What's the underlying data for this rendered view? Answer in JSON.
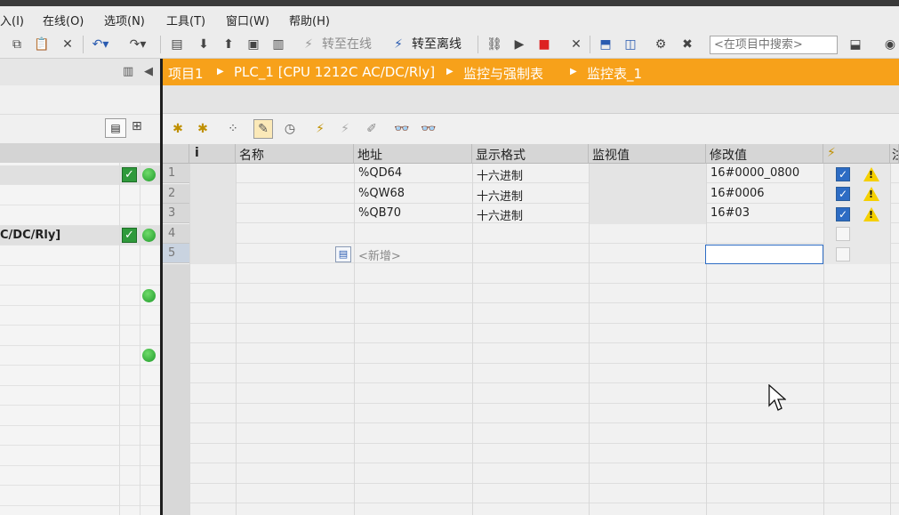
{
  "menu": [
    "入(I)",
    "在线(O)",
    "选项(N)",
    "工具(T)",
    "窗口(W)",
    "帮助(H)"
  ],
  "toolbar": {
    "go_online": "转至在线",
    "go_offline": "转至离线",
    "search_placeholder": "<在项目中搜索>"
  },
  "breadcrumb": [
    "项目1",
    "PLC_1 [CPU 1212C AC/DC/Rly]",
    "监控与强制表",
    "监控表_1"
  ],
  "left_pane": {
    "tree_label": "C/DC/Rly]"
  },
  "table": {
    "headers": {
      "info": "i",
      "name": "名称",
      "address": "地址",
      "display_format": "显示格式",
      "monitor_value": "监视值",
      "modify_value": "修改值",
      "extra": "注"
    },
    "rows": [
      {
        "num": "1",
        "name": "",
        "address": "%QD64",
        "format": "十六进制",
        "monitor": "",
        "modify": "16#0000_0800",
        "checked": true,
        "warning": true
      },
      {
        "num": "2",
        "name": "",
        "address": "%QW68",
        "format": "十六进制",
        "monitor": "",
        "modify": "16#0006",
        "checked": true,
        "warning": true
      },
      {
        "num": "3",
        "name": "",
        "address": "%QB70",
        "format": "十六进制",
        "monitor": "",
        "modify": "16#03",
        "checked": true,
        "warning": true
      },
      {
        "num": "4",
        "name": "",
        "address": "",
        "format": "",
        "monitor": "",
        "modify": "",
        "checked": false,
        "warning": false
      },
      {
        "num": "5",
        "name": "",
        "address": "<新增>",
        "format": "",
        "monitor": "",
        "modify": "",
        "checked": false,
        "warning": false
      }
    ]
  },
  "colors": {
    "accent_orange": "#f7a11a",
    "check_blue": "#2d6cc4",
    "status_green": "#2f9a3b",
    "warning_yellow": "#f5d000"
  }
}
